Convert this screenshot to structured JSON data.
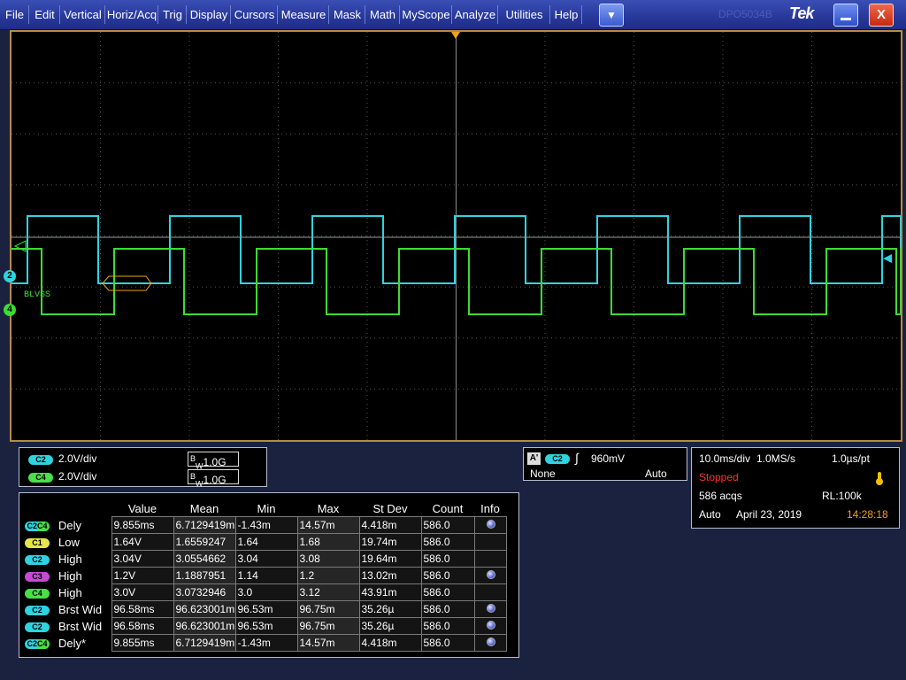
{
  "menu": {
    "items": [
      "File",
      "Edit",
      "Vertical",
      "Horiz/Acq",
      "Trig",
      "Display",
      "Cursors",
      "Measure",
      "Mask",
      "Math",
      "MyScope",
      "Analyze",
      "Utilities",
      "Help"
    ],
    "dropdown_glyph": "▼",
    "ghost_title": "DPO5034B",
    "logo": "Tek",
    "close_glyph": "X"
  },
  "graticule": {
    "ch2_marker": "2",
    "ch4_marker": "4",
    "bus_label": "BLVSS"
  },
  "channels": [
    {
      "badge": "C2",
      "scale": "2.0V/div",
      "bw": "1.0G"
    },
    {
      "badge": "C4",
      "scale": "2.0V/div",
      "bw": "1.0G"
    }
  ],
  "bw_prefix": "B",
  "bw_sub": "W",
  "trigger": {
    "mode_letter": "A'",
    "source": "C2",
    "level": "960mV",
    "coupling": "None",
    "auto": "Auto"
  },
  "timebase": {
    "scale": "10.0ms/div",
    "rate": "1.0MS/s",
    "resolution": "1.0µs/pt",
    "state": "Stopped",
    "acqs": "586 acqs",
    "rl": "RL:100k",
    "mode": "Auto",
    "date": "April 23, 2019",
    "time": "14:28:18"
  },
  "measurements": {
    "headers": [
      "Value",
      "Mean",
      "Min",
      "Max",
      "St Dev",
      "Count",
      "Info"
    ],
    "rows": [
      {
        "badge": "C2C4",
        "badge_class": "c2c4",
        "name": "Dely",
        "value": "9.855ms",
        "mean": "6.7129419m",
        "min": "-1.43m",
        "max": "14.57m",
        "stdev": "4.418m",
        "count": "586.0",
        "info": true
      },
      {
        "badge": "C1",
        "badge_class": "c1",
        "name": "Low",
        "value": "1.64V",
        "mean": "1.6559247",
        "min": "1.64",
        "max": "1.68",
        "stdev": "19.74m",
        "count": "586.0",
        "info": false
      },
      {
        "badge": "C2",
        "badge_class": "c2",
        "name": "High",
        "value": "3.04V",
        "mean": "3.0554662",
        "min": "3.04",
        "max": "3.08",
        "stdev": "19.64m",
        "count": "586.0",
        "info": false
      },
      {
        "badge": "C3",
        "badge_class": "c3",
        "name": "High",
        "value": "1.2V",
        "mean": "1.1887951",
        "min": "1.14",
        "max": "1.2",
        "stdev": "13.02m",
        "count": "586.0",
        "info": true
      },
      {
        "badge": "C4",
        "badge_class": "c4",
        "name": "High",
        "value": "3.0V",
        "mean": "3.0732946",
        "min": "3.0",
        "max": "3.12",
        "stdev": "43.91m",
        "count": "586.0",
        "info": false
      },
      {
        "badge": "C2",
        "badge_class": "c2",
        "name": "Brst Wid",
        "value": "96.58ms",
        "mean": "96.623001m",
        "min": "96.53m",
        "max": "96.75m",
        "stdev": "35.26µ",
        "count": "586.0",
        "info": true
      },
      {
        "badge": "C2",
        "badge_class": "c2",
        "name": "Brst Wid",
        "value": "96.58ms",
        "mean": "96.623001m",
        "min": "96.53m",
        "max": "96.75m",
        "stdev": "35.26µ",
        "count": "586.0",
        "info": true
      },
      {
        "badge": "C2C4",
        "badge_class": "c2c4",
        "name": "Dely*",
        "value": "9.855ms",
        "mean": "6.7129419m",
        "min": "-1.43m",
        "max": "14.57m",
        "stdev": "4.418m",
        "count": "586.0",
        "info": true
      }
    ]
  },
  "colors": {
    "ch2": "#2fd3e0",
    "ch4": "#3cdc32",
    "grid": "#555555",
    "frame": "#b88a44"
  }
}
